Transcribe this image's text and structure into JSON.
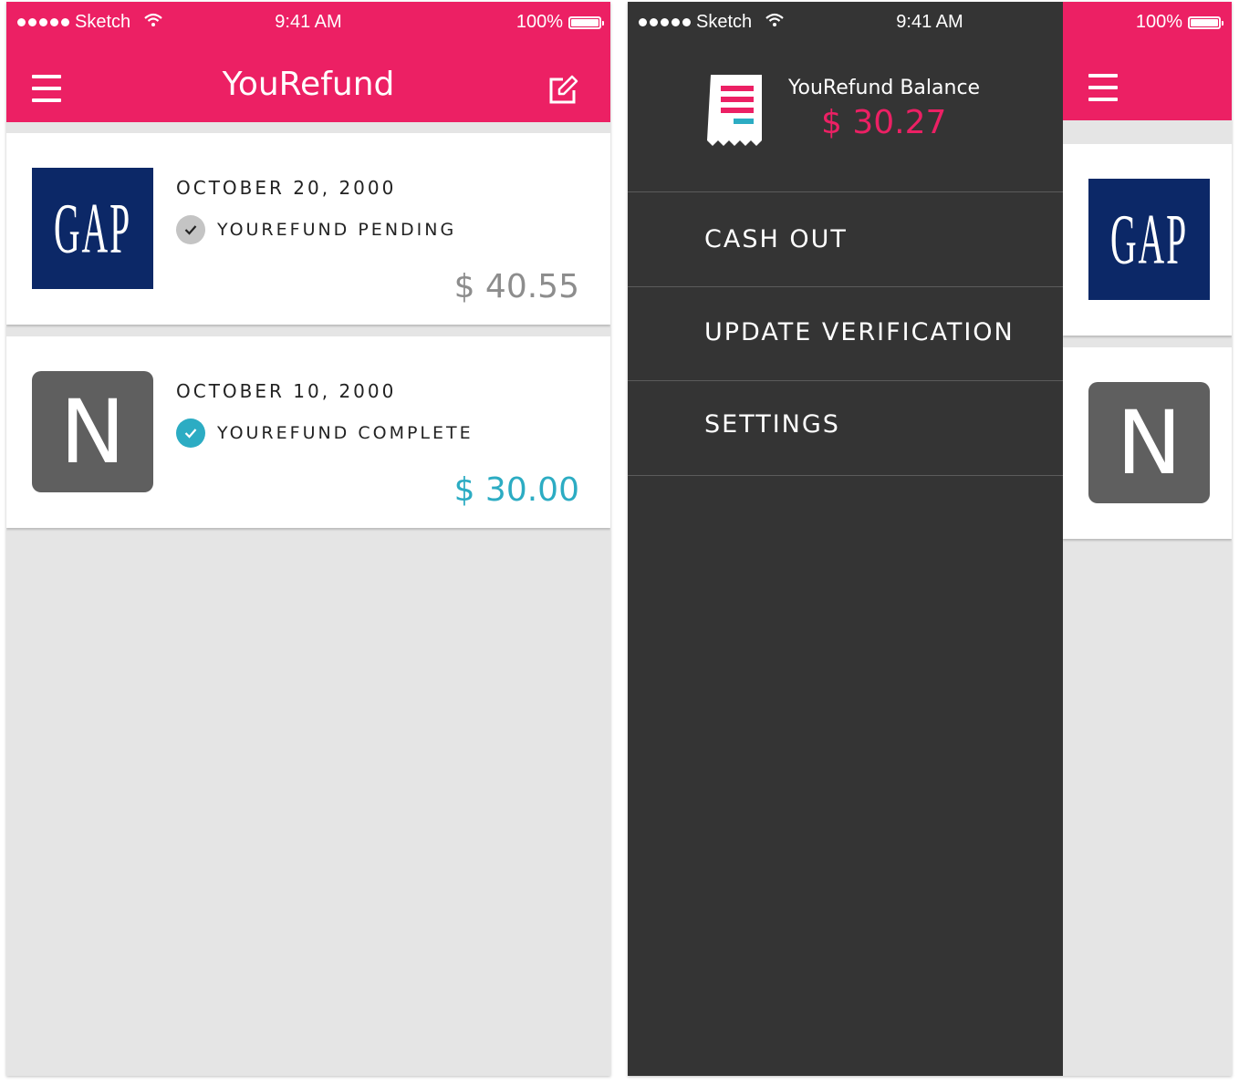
{
  "status_bar": {
    "carrier": "Sketch",
    "time": "9:41 AM",
    "battery": "100%"
  },
  "app": {
    "title": "YouRefund"
  },
  "refunds": [
    {
      "store": "GAP",
      "date": "OCTOBER 20, 2000",
      "status": "YOUREFUND PENDING",
      "amount": "$ 40.55",
      "amount_color": "#8d8d8d",
      "status_icon_color": "#c4c4c4"
    },
    {
      "store": "N",
      "date": "OCTOBER 10, 2000",
      "status": "YOUREFUND COMPLETE",
      "amount": "$ 30.00",
      "amount_color": "#2cacc3",
      "status_icon_color": "#2cacc3"
    }
  ],
  "drawer": {
    "balance_label": "YouRefund Balance",
    "balance_amount": "$ 30.27",
    "menu": [
      {
        "label": "CASH OUT"
      },
      {
        "label": "UPDATE VERIFICATION"
      },
      {
        "label": "SETTINGS"
      }
    ]
  },
  "colors": {
    "accent": "#ec2064",
    "drawer_bg": "#343434",
    "pending": "#8d8d8d",
    "complete": "#2cacc3",
    "gap_navy": "#0c2867"
  },
  "icons": [
    "hamburger-menu-icon",
    "edit-icon",
    "check-icon",
    "wifi-icon",
    "battery-icon",
    "receipt-icon"
  ]
}
